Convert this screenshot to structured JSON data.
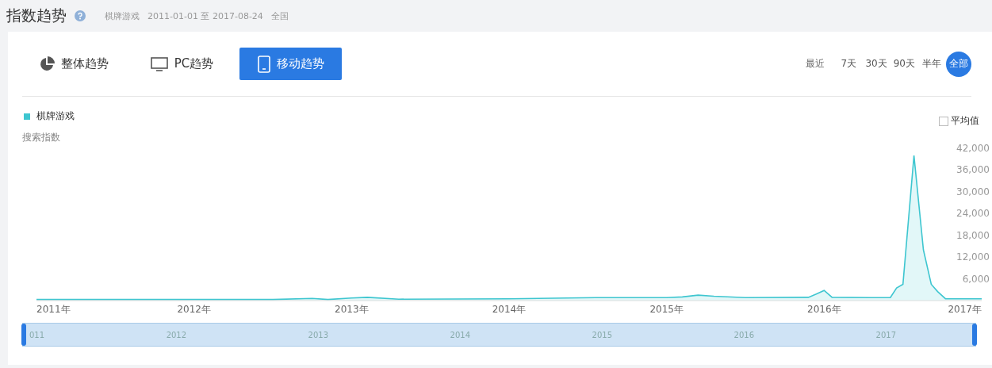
{
  "header": {
    "title": "指数趋势",
    "keyword": "棋牌游戏",
    "date_range": "2011-01-01 至 2017-08-24",
    "region": "全国"
  },
  "tabs": [
    {
      "label": "整体趋势",
      "selected": false
    },
    {
      "label": "PC趋势",
      "selected": false
    },
    {
      "label": "移动趋势",
      "selected": true
    }
  ],
  "range": {
    "label": "最近",
    "options": [
      {
        "label": "7天",
        "selected": false
      },
      {
        "label": "30天",
        "selected": false
      },
      {
        "label": "90天",
        "selected": false
      },
      {
        "label": "半年",
        "selected": false
      },
      {
        "label": "全部",
        "selected": true
      }
    ]
  },
  "average": {
    "label": "平均值",
    "checked": false
  },
  "chart_data": {
    "type": "area",
    "ylabel": "搜索指数",
    "xlim": [
      2011,
      2017
    ],
    "ylim": [
      0,
      42000
    ],
    "xticks": [
      {
        "value": 2011,
        "label": "2011年"
      },
      {
        "value": 2012,
        "label": "2012年"
      },
      {
        "value": 2013,
        "label": "2013年"
      },
      {
        "value": 2014,
        "label": "2014年"
      },
      {
        "value": 2015,
        "label": "2015年"
      },
      {
        "value": 2016,
        "label": "2016年"
      },
      {
        "value": 2017,
        "label": "2017年"
      }
    ],
    "yticks": [
      {
        "value": 6000,
        "label": "6,000"
      },
      {
        "value": 12000,
        "label": "12,000"
      },
      {
        "value": 18000,
        "label": "18,000"
      },
      {
        "value": 24000,
        "label": "24,000"
      },
      {
        "value": 30000,
        "label": "30,000"
      },
      {
        "value": 36000,
        "label": "36,000"
      },
      {
        "value": 42000,
        "label": "42,000"
      }
    ],
    "x": [
      2011,
      2012.5,
      2012.75,
      2012.85,
      2013,
      2013.1,
      2013.3,
      2014,
      2014.55,
      2015,
      2015.1,
      2015.2,
      2015.3,
      2015.5,
      2015.9,
      2015.95,
      2016,
      2016.05,
      2016.3,
      2016.42,
      2016.46,
      2016.5,
      2016.57,
      2016.63,
      2016.68,
      2016.72,
      2016.77,
      2017
    ],
    "series": [
      {
        "name": "棋牌游戏",
        "color": "#3ec6d0",
        "values": [
          300,
          300,
          600,
          300,
          700,
          900,
          400,
          500,
          800,
          800,
          1000,
          1500,
          1200,
          800,
          900,
          1800,
          2800,
          900,
          800,
          800,
          3500,
          4500,
          40000,
          14000,
          4500,
          2500,
          500,
          500
        ]
      }
    ]
  },
  "navigator": {
    "labels": [
      "011",
      "2012",
      "2013",
      "2014",
      "2015",
      "2016",
      "2017"
    ]
  }
}
